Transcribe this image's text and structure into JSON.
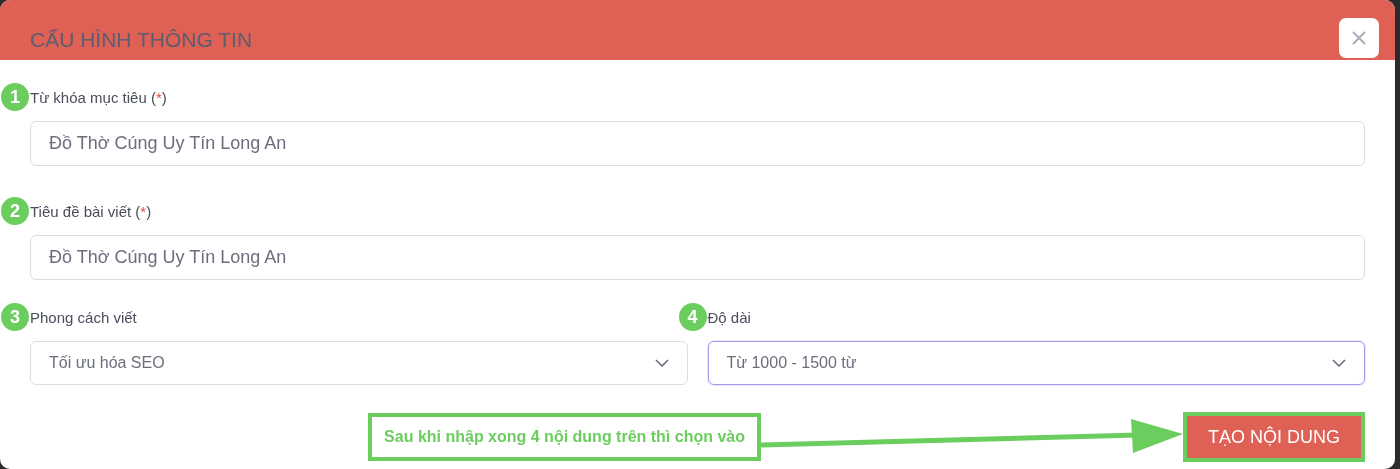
{
  "dialog": {
    "title": "CẤU HÌNH THÔNG TIN"
  },
  "fields": [
    {
      "kind": "input",
      "step": "1",
      "label": "Từ khóa mục tiêu (",
      "required_mark": "*",
      "label_end": ")",
      "value": "Đồ Thờ Cúng Uy Tín Long An",
      "focused": false
    },
    {
      "kind": "input",
      "step": "2",
      "label": "Tiêu đề bài viết (",
      "required_mark": "*",
      "label_end": ")",
      "value": "Đồ Thờ Cúng Uy Tín Long An",
      "focused": false
    },
    {
      "kind": "select",
      "step": "3",
      "label": "Phong cách viết",
      "value": "Tối ưu hóa SEO",
      "focused": false
    },
    {
      "kind": "select",
      "step": "4",
      "label": "Độ dài",
      "value": "Từ 1000 - 1500 từ",
      "focused": true
    }
  ],
  "callout": {
    "text": "Sau khi nhập xong 4 nội dung trên thì chọn vào"
  },
  "submit_button": {
    "label": "TẠO NỘI DUNG",
    "highlighted": true
  }
}
